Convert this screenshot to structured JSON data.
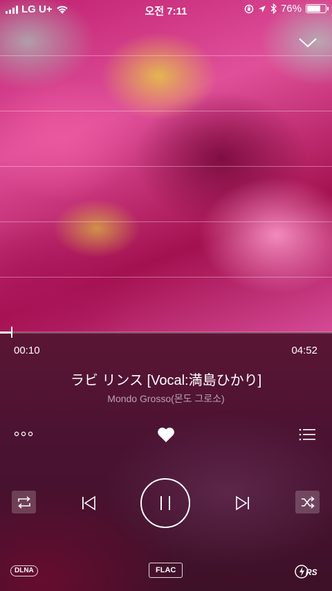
{
  "status_bar": {
    "carrier": "LG U+",
    "time": "오전 7:11",
    "battery": "76%",
    "battery_level": 0.76
  },
  "player": {
    "current_time": "00:10",
    "total_time": "04:52",
    "progress": 0.034,
    "track_title": "ラビ リンス [Vocal:満島ひかり]",
    "artist": "Mondo Grosso(몬도 그로소)",
    "badges": {
      "dlna": "DLNA",
      "flac": "FLAC",
      "rs": "RS"
    }
  },
  "icons": {
    "collapse": "chevron-down-icon",
    "more": "more-icon",
    "like": "heart-icon",
    "playlist": "playlist-icon",
    "repeat": "repeat-icon",
    "previous": "previous-icon",
    "pause": "pause-icon",
    "next": "next-icon",
    "shuffle": "shuffle-icon"
  },
  "colors": {
    "accent": "#ffffff",
    "panel": "#4a1231"
  }
}
